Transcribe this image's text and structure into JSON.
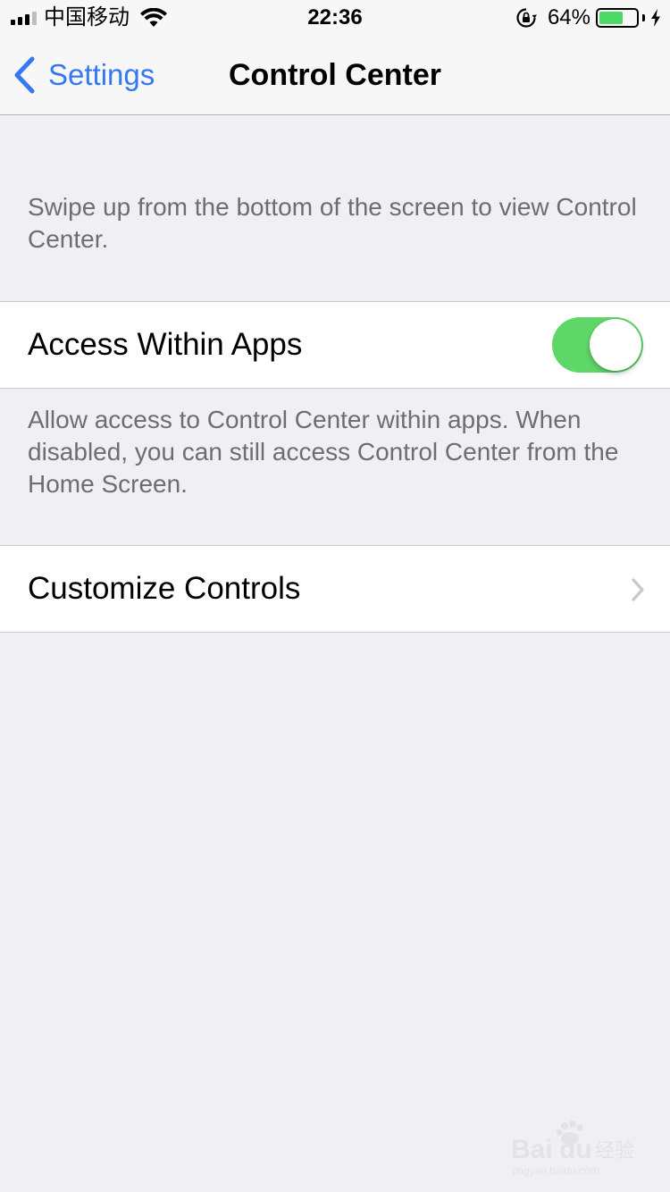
{
  "status_bar": {
    "carrier": "中国移动",
    "time": "22:36",
    "battery_percent": "64%",
    "battery_level": 0.64,
    "icons": [
      "signal-icon",
      "wifi-icon",
      "orientation-lock-icon",
      "battery-icon",
      "charging-bolt-icon"
    ]
  },
  "nav": {
    "back_label": "Settings",
    "title": "Control Center"
  },
  "content": {
    "intro_note": "Swipe up from the bottom of the screen to view Control Center.",
    "access_row": {
      "label": "Access Within Apps",
      "toggle_on": true
    },
    "access_note": "Allow access to Control Center within apps. When disabled, you can still access Control Center from the Home Screen.",
    "customize_row": {
      "label": "Customize Controls"
    }
  },
  "watermark": {
    "text": "Baidu经验",
    "subtext": "jingyan.baidu.com"
  },
  "colors": {
    "accent_blue": "#3478f6",
    "toggle_green": "#5fd668",
    "battery_green": "#4cd964",
    "background": "#efeff4",
    "secondary_text": "#6d6d72"
  }
}
